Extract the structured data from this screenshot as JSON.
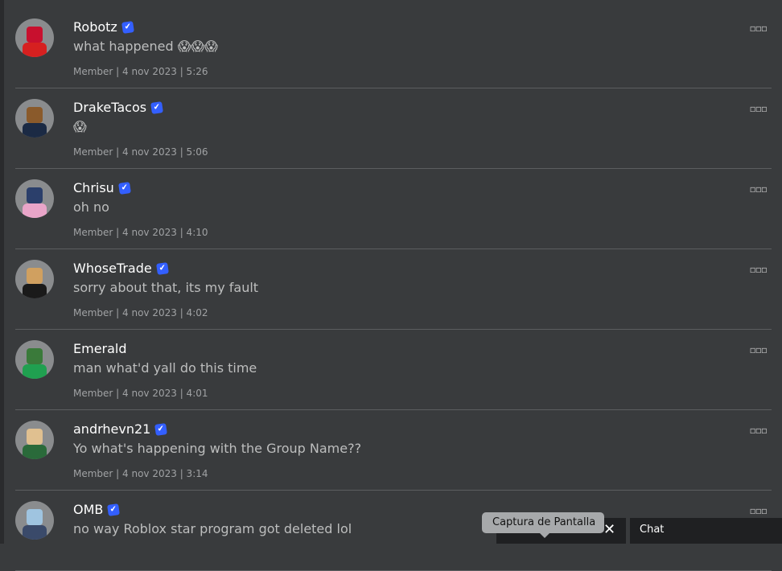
{
  "posts": [
    {
      "name": "Robotz",
      "verified": true,
      "message": "what happened 😱😱😱",
      "meta": "Member | 4 nov 2023 | 5:26",
      "avatar": {
        "head": "#c8102e",
        "body": "#d62020"
      }
    },
    {
      "name": "DrakeTacos",
      "verified": true,
      "message": "😱",
      "meta": "Member | 4 nov 2023 | 5:06",
      "avatar": {
        "head": "#8a5a2b",
        "body": "#1b2a44"
      }
    },
    {
      "name": "Chrisu",
      "verified": true,
      "message": "oh no",
      "meta": "Member | 4 nov 2023 | 4:10",
      "avatar": {
        "head": "#2b3f6b",
        "body": "#e9a5c9"
      }
    },
    {
      "name": "WhoseTrade",
      "verified": true,
      "message": "sorry about that, its my fault",
      "meta": "Member | 4 nov 2023 | 4:02",
      "avatar": {
        "head": "#d0a060",
        "body": "#1a1a1a"
      }
    },
    {
      "name": "Emerald",
      "verified": false,
      "message": "man what'd yall do this time",
      "meta": "Member | 4 nov 2023 | 4:01",
      "avatar": {
        "head": "#3a7a3a",
        "body": "#20a050"
      }
    },
    {
      "name": "andrhevn21",
      "verified": true,
      "message": "Yo what's happening with the Group Name??",
      "meta": "Member | 4 nov 2023 | 3:14",
      "avatar": {
        "head": "#e0c090",
        "body": "#2a6a3a"
      }
    },
    {
      "name": "OMB",
      "verified": true,
      "message": "no way Roblox star program got deleted lol",
      "meta": "",
      "avatar": {
        "head": "#9fc4e0",
        "body": "#3a4a6a"
      }
    }
  ],
  "more_icon": "ellipsis-icon",
  "verified_icon": "verified-badge-icon",
  "tooltip": "Captura de Pantalla",
  "chat_label": "Chat",
  "close_icon": "✕",
  "colors": {
    "background": "#393b3d",
    "verified": "#335fff"
  }
}
